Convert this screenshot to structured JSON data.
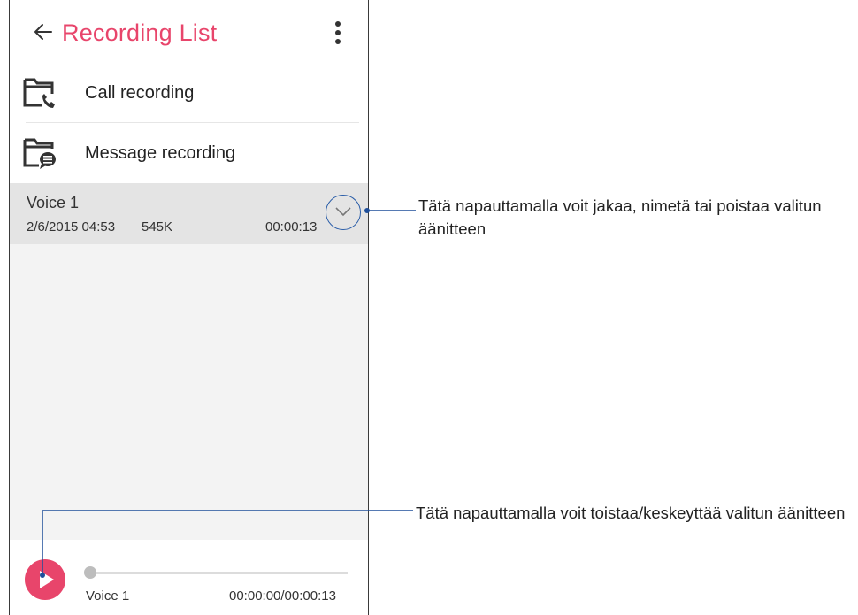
{
  "appbar": {
    "back_icon": "arrow-left-icon",
    "title": "Recording List",
    "more_icon": "more-vertical-icon",
    "title_color": "#e8456b"
  },
  "menu": [
    {
      "label": "Call recording",
      "icon": "call-recording-folder-icon"
    },
    {
      "label": "Message recording",
      "icon": "message-recording-folder-icon"
    }
  ],
  "recordings": [
    {
      "name": "Voice 1",
      "date": "2/6/2015 04:53",
      "size": "545K",
      "duration": "00:00:13"
    }
  ],
  "player": {
    "track_name": "Voice 1",
    "time": "00:00:00/00:00:13",
    "progress": 0,
    "accent": "#e8456b"
  },
  "callouts": [
    {
      "text": "Tätä napauttamalla voit jakaa, nimetä tai poistaa valitun äänitteen"
    },
    {
      "text": "Tätä napauttamalla voit toistaa/keskeyttää valitun äänitteen"
    }
  ]
}
